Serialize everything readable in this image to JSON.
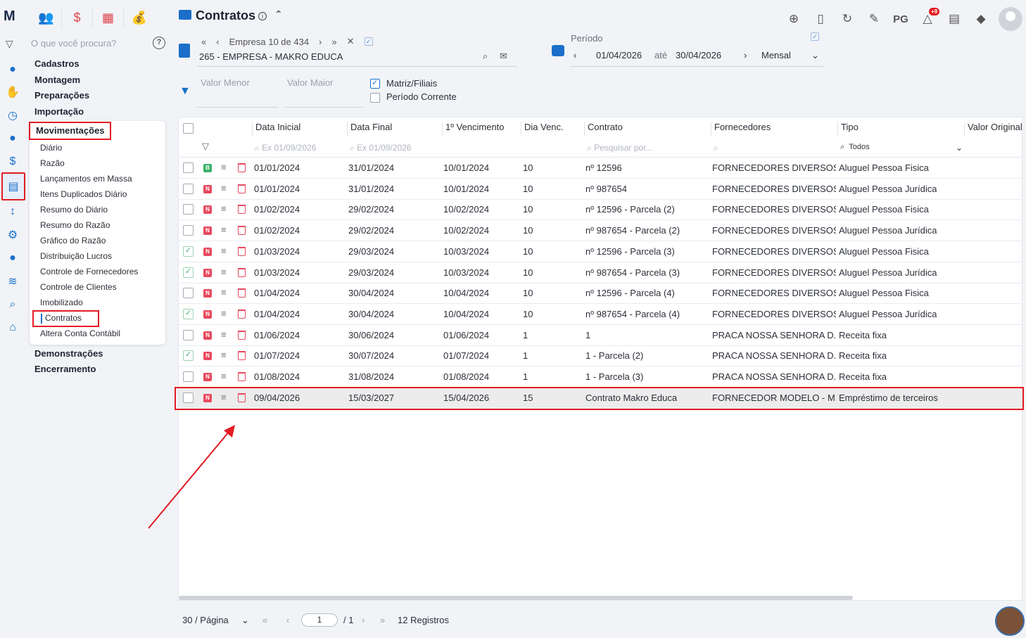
{
  "app": {
    "logo": "M",
    "search_placeholder": "O que você procura?",
    "help": "?"
  },
  "modules": [
    "👥",
    "$",
    "▦",
    "💰"
  ],
  "menu": {
    "groups": {
      "cadastros": "Cadastros",
      "montagem": "Montagem",
      "preparacoes": "Preparações",
      "importacao": "Importação",
      "movimentacoes": "Movimentações",
      "demonstracoes": "Demonstrações",
      "encerramento": "Encerramento"
    },
    "items": [
      "Diário",
      "Razão",
      "Lançamentos em Massa",
      "Itens Duplicados Diário",
      "Resumo do Diário",
      "Resumo do Razão",
      "Gráfico do Razão",
      "Distribuição Lucros",
      "Controle de Fornecedores",
      "Controle de Clientes",
      "Imobilizado",
      "Contratos",
      "Altera Conta Contábil"
    ]
  },
  "header": {
    "title": "Contratos",
    "info": "i",
    "pg": "PG",
    "badge": "+9"
  },
  "empresa": {
    "first": "«",
    "prev": "‹",
    "label": "Empresa 10 de 434",
    "next": "›",
    "last": "»",
    "close": "✕",
    "name": "265 - EMPRESA - MAKRO EDUCA"
  },
  "periodo": {
    "label": "Período",
    "start": "01/04/2026",
    "ate": "até",
    "end": "30/04/2026",
    "mode": "Mensal"
  },
  "filters": {
    "valor_menor": "Valor Menor",
    "valor_maior": "Valor Maior",
    "matriz": "Matriz/Filiais",
    "periodo_corrente": "Período Corrente"
  },
  "table": {
    "columns": {
      "data_inicial": "Data Inicial",
      "data_final": "Data Final",
      "vencimento": "1º Vencimento",
      "dia_venc": "Dia Venc.",
      "contrato": "Contrato",
      "fornecedores": "Fornecedores",
      "tipo": "Tipo",
      "valor": "Valor Original"
    },
    "filter_placeholders": {
      "data_inicial": "Ex 01/09/2026",
      "data_final": "Ex 01/09/2026",
      "contrato": "Pesquisar por...",
      "tipo": "Todos"
    },
    "rows": [
      {
        "checked": false,
        "tag": "B",
        "di": "01/01/2024",
        "df": "31/01/2024",
        "v": "10/01/2024",
        "dia": "10",
        "contrato": "nº 12596",
        "forn": "FORNECEDORES DIVERSOS ...",
        "tipo": "Aluguel Pessoa Fisica"
      },
      {
        "checked": false,
        "tag": "N",
        "di": "01/01/2024",
        "df": "31/01/2024",
        "v": "10/01/2024",
        "dia": "10",
        "contrato": "nº 987654",
        "forn": "FORNECEDORES DIVERSOS ...",
        "tipo": "Aluguel Pessoa Jurídica"
      },
      {
        "checked": false,
        "tag": "N",
        "di": "01/02/2024",
        "df": "29/02/2024",
        "v": "10/02/2024",
        "dia": "10",
        "contrato": "nº 12596 - Parcela (2)",
        "forn": "FORNECEDORES DIVERSOS ...",
        "tipo": "Aluguel Pessoa Fisica"
      },
      {
        "checked": false,
        "tag": "N",
        "di": "01/02/2024",
        "df": "29/02/2024",
        "v": "10/02/2024",
        "dia": "10",
        "contrato": "nº 987654 - Parcela (2)",
        "forn": "FORNECEDORES DIVERSOS ...",
        "tipo": "Aluguel Pessoa Jurídica"
      },
      {
        "checked": true,
        "tag": "N",
        "di": "01/03/2024",
        "df": "29/03/2024",
        "v": "10/03/2024",
        "dia": "10",
        "contrato": "nº 12596 - Parcela (3)",
        "forn": "FORNECEDORES DIVERSOS ...",
        "tipo": "Aluguel Pessoa Fisica"
      },
      {
        "checked": true,
        "tag": "N",
        "di": "01/03/2024",
        "df": "29/03/2024",
        "v": "10/03/2024",
        "dia": "10",
        "contrato": "nº 987654 - Parcela (3)",
        "forn": "FORNECEDORES DIVERSOS ...",
        "tipo": "Aluguel Pessoa Jurídica"
      },
      {
        "checked": false,
        "tag": "N",
        "di": "01/04/2024",
        "df": "30/04/2024",
        "v": "10/04/2024",
        "dia": "10",
        "contrato": "nº 12596 - Parcela (4)",
        "forn": "FORNECEDORES DIVERSOS ...",
        "tipo": "Aluguel Pessoa Fisica"
      },
      {
        "checked": true,
        "tag": "N",
        "di": "01/04/2024",
        "df": "30/04/2024",
        "v": "10/04/2024",
        "dia": "10",
        "contrato": "nº 987654 - Parcela (4)",
        "forn": "FORNECEDORES DIVERSOS ...",
        "tipo": "Aluguel Pessoa Jurídica"
      },
      {
        "checked": false,
        "tag": "N",
        "di": "01/06/2024",
        "df": "30/06/2024",
        "v": "01/06/2024",
        "dia": "1",
        "contrato": "1",
        "forn": "PRACA NOSSA SENHORA D...",
        "tipo": "Receita fixa"
      },
      {
        "checked": true,
        "tag": "N",
        "di": "01/07/2024",
        "df": "30/07/2024",
        "v": "01/07/2024",
        "dia": "1",
        "contrato": "1 - Parcela (2)",
        "forn": "PRACA NOSSA SENHORA D...",
        "tipo": "Receita fixa"
      },
      {
        "checked": false,
        "tag": "N",
        "di": "01/08/2024",
        "df": "31/08/2024",
        "v": "01/08/2024",
        "dia": "1",
        "contrato": "1 - Parcela (3)",
        "forn": "PRACA NOSSA SENHORA D...",
        "tipo": "Receita fixa"
      },
      {
        "checked": false,
        "tag": "N",
        "di": "09/04/2026",
        "df": "15/03/2027",
        "v": "15/04/2026",
        "dia": "15",
        "contrato": "Contrato Makro Educa",
        "forn": "FORNECEDOR MODELO - M...",
        "tipo": "Empréstimo de terceiros"
      }
    ]
  },
  "pagination": {
    "per_page": "30 / Página",
    "first": "«",
    "prev": "‹",
    "page": "1",
    "total": "/ 1",
    "next": "›",
    "last": "»",
    "records": "12 Registros"
  }
}
